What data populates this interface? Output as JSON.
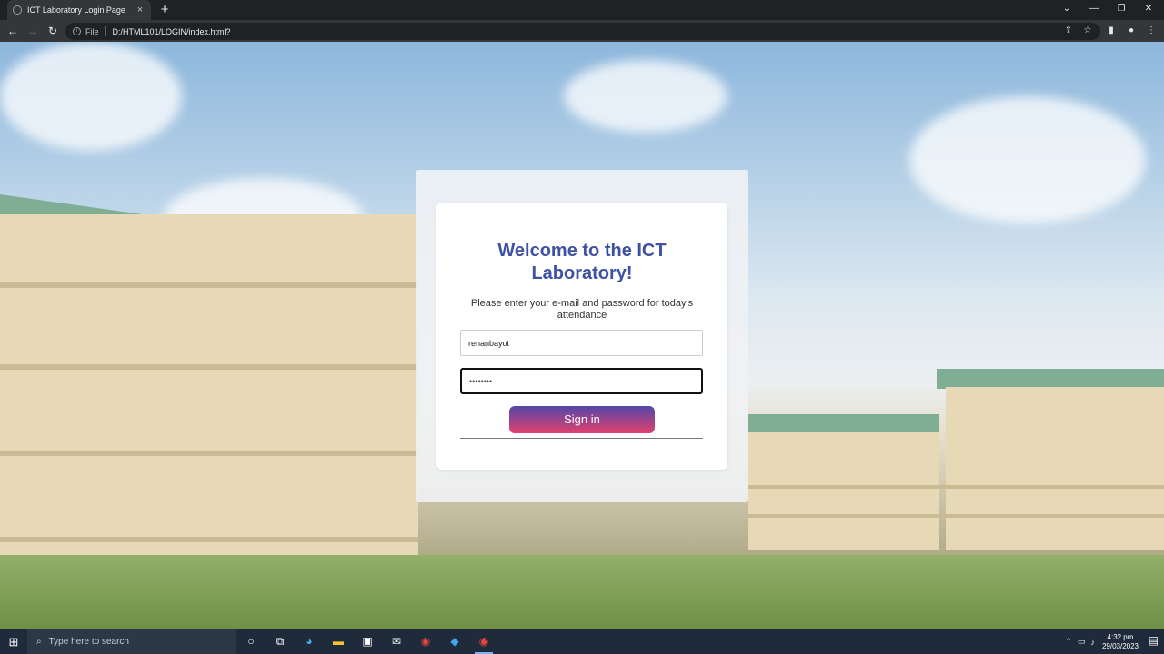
{
  "browser": {
    "tab_title": "ICT Laboratory Login Page",
    "new_tab": "+",
    "close_tab": "×",
    "security_label": "File",
    "url": "D:/HTML101/LOGIN/index.html?"
  },
  "page": {
    "title": "Welcome to the ICT Laboratory!",
    "subtitle": "Please enter your e-mail and password for today's attendance",
    "username_value": "renanbayot",
    "password_value": "••••••••",
    "signin_label": "Sign in",
    "colors": {
      "title": "#3f51a2",
      "button_start": "#5247a8",
      "button_end": "#e3406e"
    }
  },
  "taskbar": {
    "search_placeholder": "Type here to search",
    "time": "4:32 pm",
    "date": "29/03/2023"
  }
}
